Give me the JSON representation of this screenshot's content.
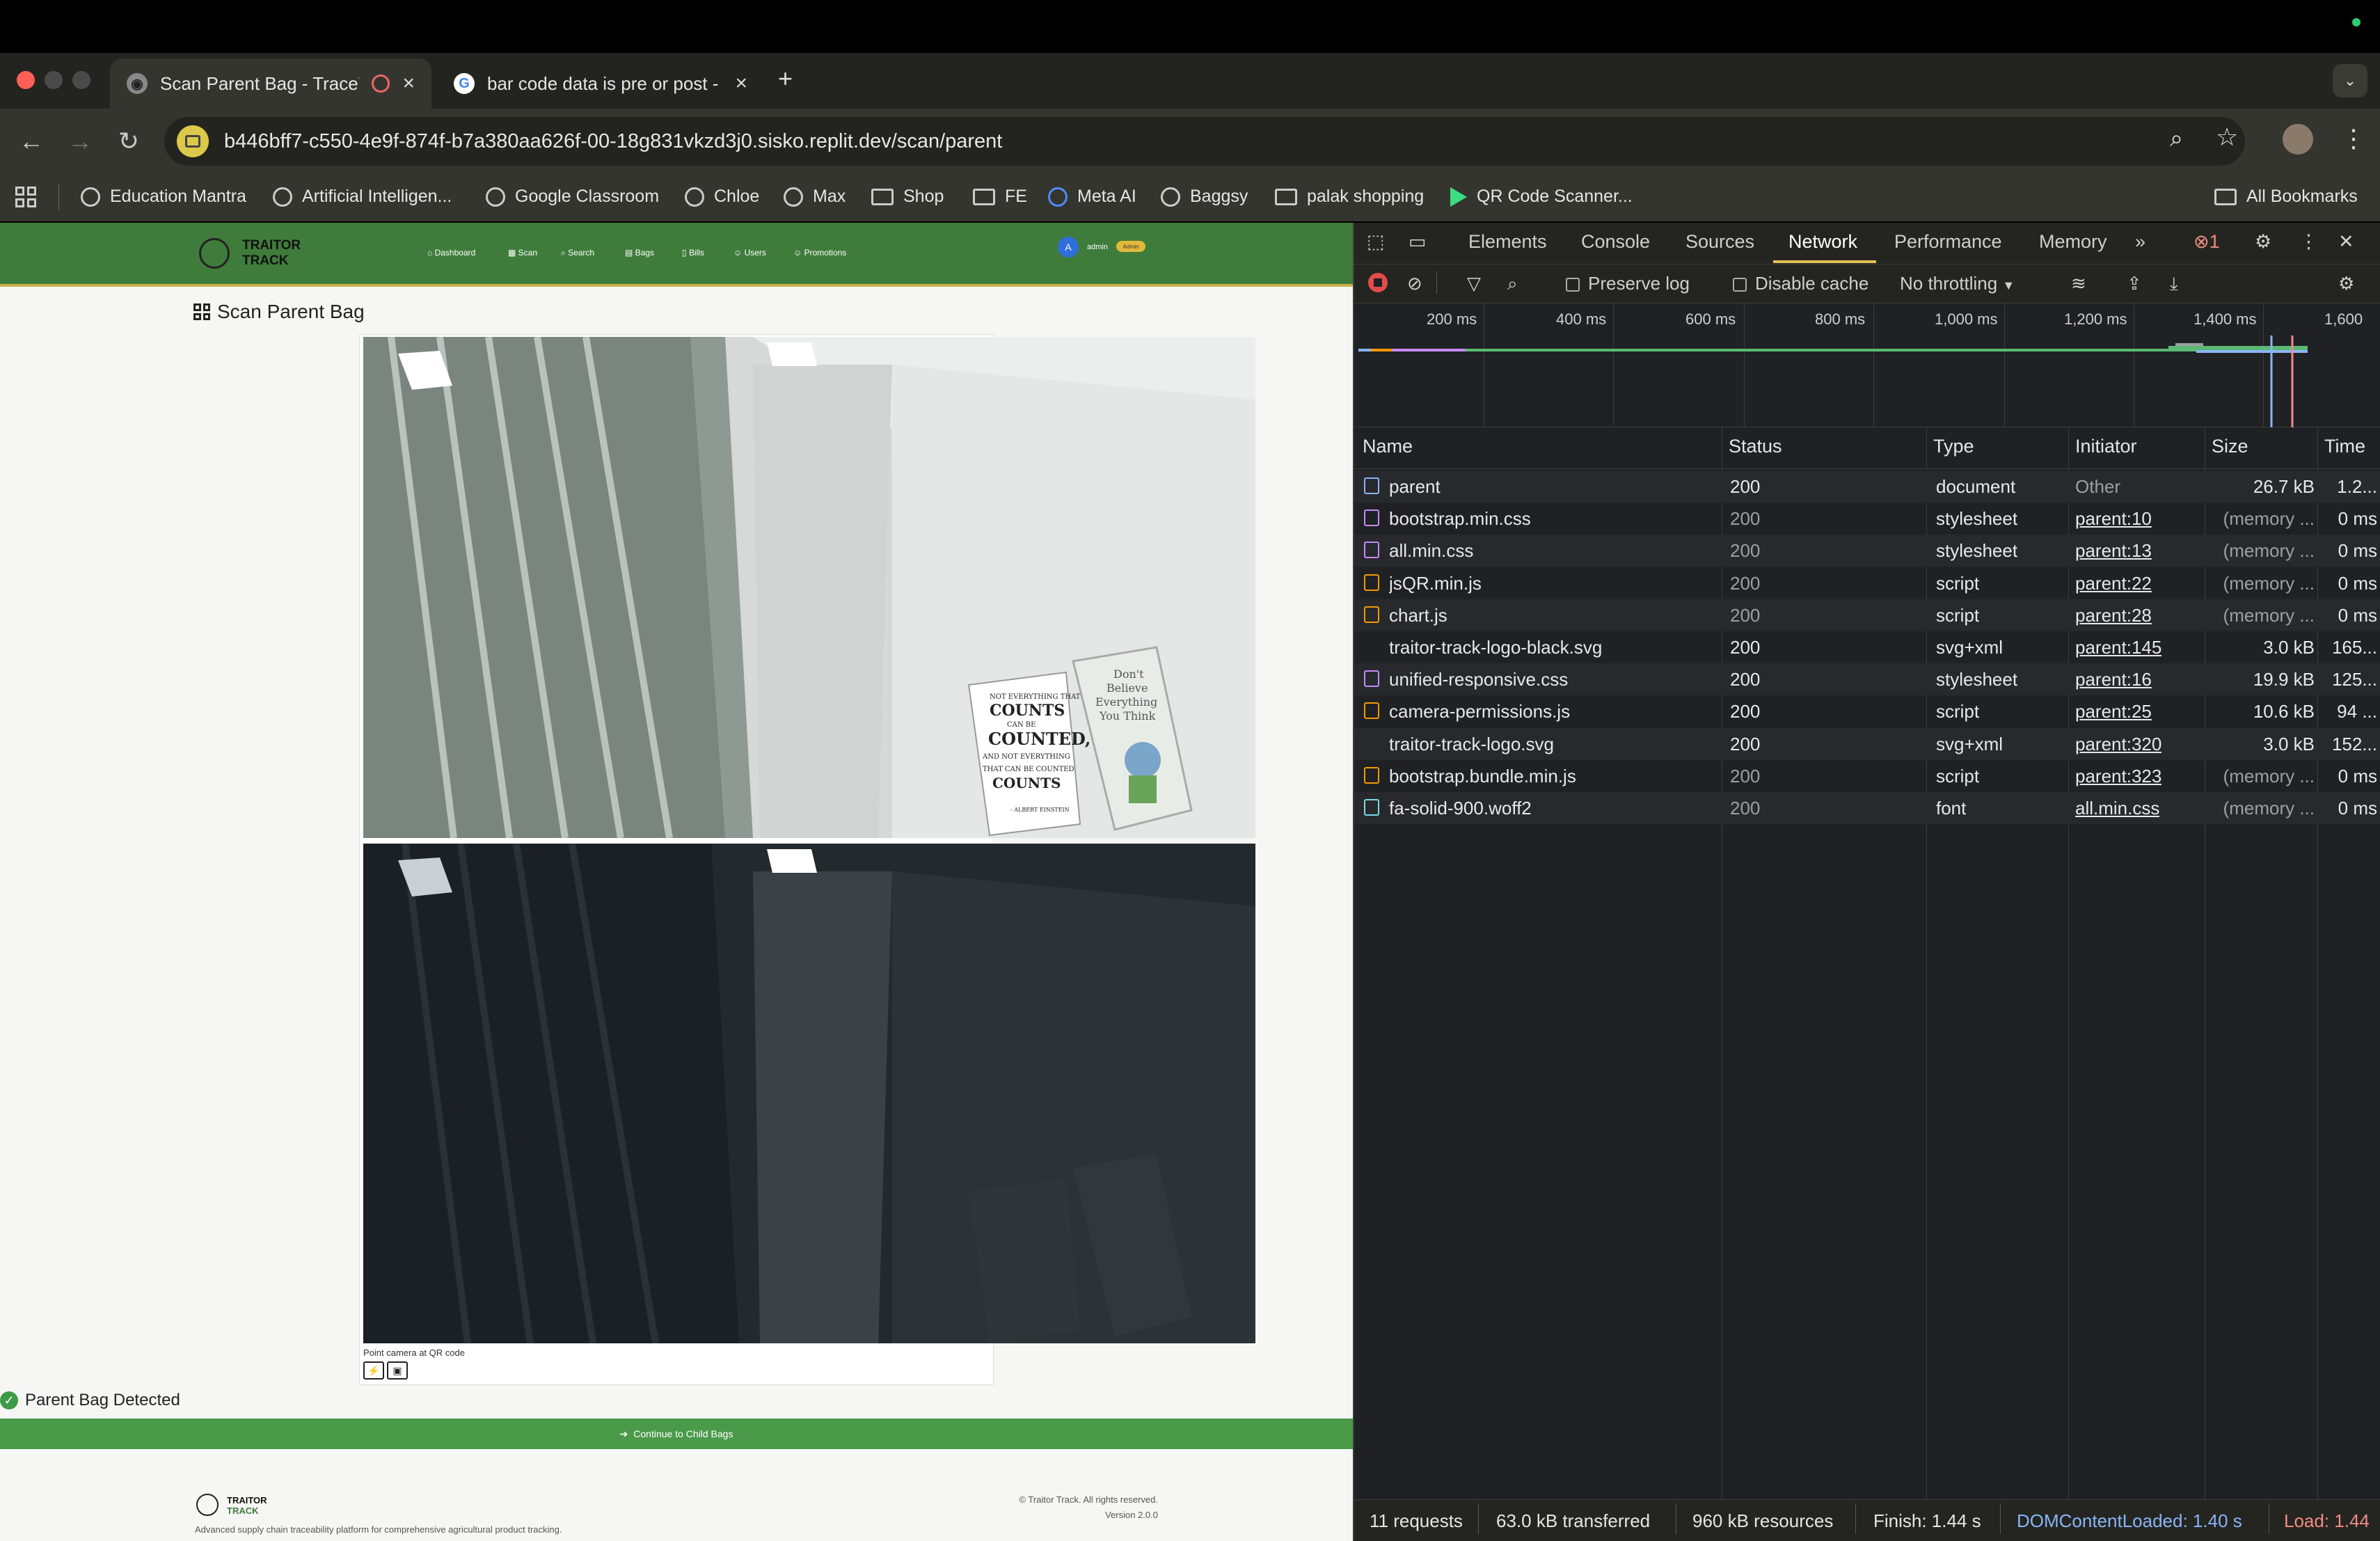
{
  "browser": {
    "tabs": [
      {
        "title": "Scan Parent Bag - TraceTrack",
        "active": true
      },
      {
        "title": "bar code data is pre or post -",
        "active": false
      }
    ],
    "new_tab": "+",
    "url": "b446bff7-c550-4e9f-874f-b7a380aa626f-00-18g831vkzd3j0.sisko.replit.dev/scan/parent",
    "bookmarks": [
      {
        "label": "Education Mantra",
        "icon": "globe-icon"
      },
      {
        "label": "Artificial Intelligen...",
        "icon": "globe-icon"
      },
      {
        "label": "Google Classroom",
        "icon": "globe-icon"
      },
      {
        "label": "Chloe",
        "icon": "globe-icon"
      },
      {
        "label": "Max",
        "icon": "globe-icon"
      },
      {
        "label": "Shop",
        "icon": "folder-icon"
      },
      {
        "label": "FE",
        "icon": "folder-icon"
      },
      {
        "label": "Meta AI",
        "icon": "meta-icon"
      },
      {
        "label": "Baggsy",
        "icon": "openai-icon"
      },
      {
        "label": "palak shopping",
        "icon": "folder-icon"
      },
      {
        "label": "QR Code Scanner...",
        "icon": "play-icon"
      }
    ],
    "all_bookmarks": "All Bookmarks"
  },
  "app": {
    "brand_line1": "TRAITOR",
    "brand_line2": "TRACK",
    "nav": [
      "Dashboard",
      "Scan",
      "Search",
      "Bags",
      "Bills",
      "Users",
      "Promotions"
    ],
    "user_initial": "A",
    "user_name": "admin",
    "user_role": "Admin",
    "page_title": "Scan Parent Bag",
    "camera_hint": "Point camera at QR code",
    "status_message": "Parent Bag Detected",
    "continue_button": "Continue to Child Bags",
    "footer_tagline": "Advanced supply chain traceability platform for comprehensive agricultural product tracking.",
    "footer_copyright": "© Traitor Track. All rights reserved.",
    "footer_version": "Version 2.0.0",
    "poster_text": [
      "NOT EVERYTHING THAT",
      "COUNTS",
      "CAN BE",
      "COUNTED,",
      "AND NOT EVERYTHING",
      "THAT CAN BE COUNTED",
      "COUNTS"
    ],
    "poster_author": "- ALBERT EINSTEIN",
    "book_text": [
      "Don't",
      "Believe",
      "Everything",
      "You Think"
    ]
  },
  "devtools": {
    "tabs": [
      "Elements",
      "Console",
      "Sources",
      "Network",
      "Performance",
      "Memory"
    ],
    "more": "»",
    "active_tab": "Network",
    "error_count": "1",
    "preserve_log": "Preserve log",
    "disable_cache": "Disable cache",
    "throttling": "No throttling",
    "timeline_ticks": [
      "200 ms",
      "400 ms",
      "600 ms",
      "800 ms",
      "1,000 ms",
      "1,200 ms",
      "1,400 ms",
      "1,600"
    ],
    "columns": [
      "Name",
      "Status",
      "Type",
      "Initiator",
      "Size",
      "Time"
    ],
    "requests": [
      {
        "name": "parent",
        "status": "200",
        "type": "document",
        "initiator": "Other",
        "size": "26.7 kB",
        "time": "1.2...",
        "kind": "doc"
      },
      {
        "name": "bootstrap.min.css",
        "status": "200",
        "type": "stylesheet",
        "initiator": "parent:10",
        "size": "(memory ...",
        "time": "0 ms",
        "kind": "css"
      },
      {
        "name": "all.min.css",
        "status": "200",
        "type": "stylesheet",
        "initiator": "parent:13",
        "size": "(memory ...",
        "time": "0 ms",
        "kind": "css"
      },
      {
        "name": "jsQR.min.js",
        "status": "200",
        "type": "script",
        "initiator": "parent:22",
        "size": "(memory ...",
        "time": "0 ms",
        "kind": "js"
      },
      {
        "name": "chart.js",
        "status": "200",
        "type": "script",
        "initiator": "parent:28",
        "size": "(memory ...",
        "time": "0 ms",
        "kind": "js"
      },
      {
        "name": "traitor-track-logo-black.svg",
        "status": "200",
        "type": "svg+xml",
        "initiator": "parent:145",
        "size": "3.0 kB",
        "time": "165...",
        "kind": "img"
      },
      {
        "name": "unified-responsive.css",
        "status": "200",
        "type": "stylesheet",
        "initiator": "parent:16",
        "size": "19.9 kB",
        "time": "125...",
        "kind": "css"
      },
      {
        "name": "camera-permissions.js",
        "status": "200",
        "type": "script",
        "initiator": "parent:25",
        "size": "10.6 kB",
        "time": "94 ...",
        "kind": "js"
      },
      {
        "name": "traitor-track-logo.svg",
        "status": "200",
        "type": "svg+xml",
        "initiator": "parent:320",
        "size": "3.0 kB",
        "time": "152...",
        "kind": "img"
      },
      {
        "name": "bootstrap.bundle.min.js",
        "status": "200",
        "type": "script",
        "initiator": "parent:323",
        "size": "(memory ...",
        "time": "0 ms",
        "kind": "js"
      },
      {
        "name": "fa-solid-900.woff2",
        "status": "200",
        "type": "font",
        "initiator": "all.min.css",
        "size": "(memory ...",
        "time": "0 ms",
        "kind": "font"
      }
    ],
    "status_bar": {
      "requests": "11 requests",
      "transferred": "63.0 kB transferred",
      "resources": "960 kB resources",
      "finish": "Finish: 1.44 s",
      "dom": "DOMContentLoaded: 1.40 s",
      "load": "Load: 1.44"
    },
    "colors": {
      "accent": "#e4c255",
      "dom": "#8ab4f8",
      "load": "#f28b82",
      "css": "#c58af9",
      "js": "#f29900",
      "doc": "#8ab4f8",
      "font": "#78d9ec"
    }
  },
  "colors": {
    "navbar": "#3f7c3b",
    "button": "#4a9a4a"
  }
}
